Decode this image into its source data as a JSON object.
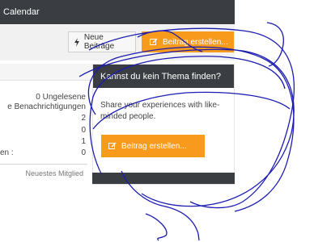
{
  "header": {
    "title": "Calendar"
  },
  "toolbar": {
    "neue_beitraege": "Neue Beiträge",
    "beitrag_erstellen": "Beitrag erstellen..."
  },
  "stats": {
    "ungelesene": "0 Ungelesene",
    "benachrichtigungen": "e Benachrichtigungen",
    "val1": "2",
    "val2": "0",
    "val3": "1",
    "last_label": "en :",
    "last_value": "0",
    "neuestes_mitglied": "Neuestes Mitglied"
  },
  "card": {
    "title": "Kannst du kein Thema finden?",
    "text": "Share your experiences with like-minded people.",
    "button": "Beitrag erstellen..."
  },
  "colors": {
    "dark": "#3a3d42",
    "accent": "#f89a1c",
    "scribble": "#1b1bb0"
  }
}
